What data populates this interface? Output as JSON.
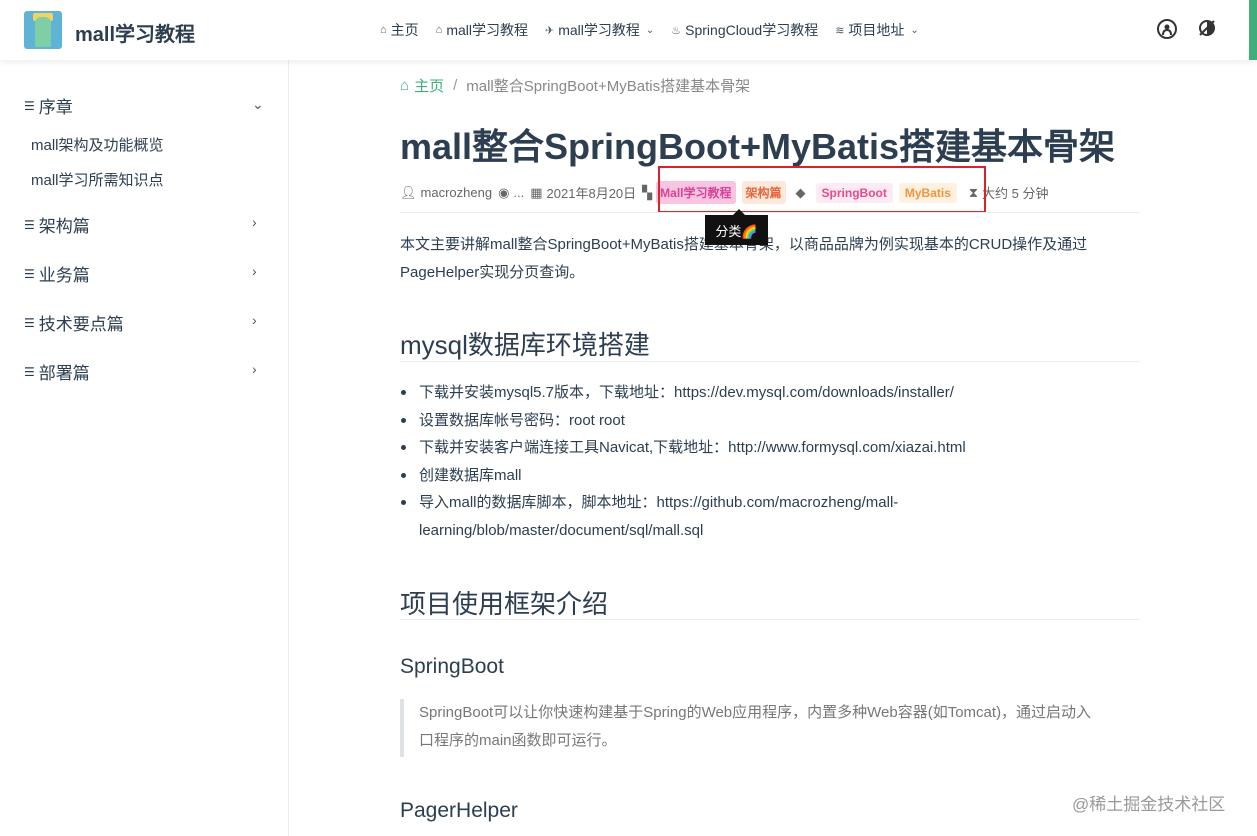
{
  "navbar": {
    "site_name": "mall学习教程",
    "links": [
      {
        "icon": "home-icon",
        "label": "主页"
      },
      {
        "icon": "home-icon",
        "label": "mall学习教程"
      },
      {
        "icon": "rocket-icon",
        "label": "mall学习教程"
      },
      {
        "icon": "fire-icon",
        "label": "SpringCloud学习教程"
      },
      {
        "icon": "layers-icon",
        "label": "项目地址"
      }
    ],
    "right_icons": [
      "github-icon",
      "theme-toggle-icon"
    ]
  },
  "sidebar": {
    "groups": [
      {
        "label": "序章",
        "expanded": true,
        "children": [
          "mall架构及功能概览",
          "mall学习所需知识点"
        ]
      },
      {
        "label": "架构篇",
        "expanded": false
      },
      {
        "label": "业务篇",
        "expanded": false
      },
      {
        "label": "技术要点篇",
        "expanded": false
      },
      {
        "label": "部署篇",
        "expanded": false
      }
    ]
  },
  "breadcrumb": {
    "home": "主页",
    "current": "mall整合SpringBoot+MyBatis搭建基本骨架"
  },
  "article": {
    "title": "mall整合SpringBoot+MyBatis搭建基本骨架",
    "meta": {
      "author": "macrozheng",
      "views": "...",
      "date": "2021年8月20日",
      "categories": [
        "Mall学习教程",
        "架构篇"
      ],
      "tags": [
        "SpringBoot",
        "MyBatis"
      ],
      "reading_time": "大约 5 分钟"
    },
    "tooltip": "分类🌈",
    "intro_line1": "本文主要讲解mall整合SpringBoot+MyBatis搭建基本骨架，以商品品牌为例实现基本的CRUD操作及通过",
    "intro_line2": "PageHelper实现分页查询。",
    "section1": {
      "heading": "mysql数据库环境搭建",
      "items": [
        "下载并安装mysql5.7版本，下载地址：https://dev.mysql.com/downloads/installer/",
        "设置数据库帐号密码：root root",
        "下载并安装客户端连接工具Navicat,下载地址：http://www.formysql.com/xiazai.html",
        "创建数据库mall",
        "导入mall的数据库脚本，脚本地址：https://github.com/macrozheng/mall-",
        "learning/blob/master/document/sql/mall.sql"
      ]
    },
    "section2": {
      "heading": "项目使用框架介绍",
      "sub1_heading": "SpringBoot",
      "sub1_quote_line1": "SpringBoot可以让你快速构建基于Spring的Web应用程序，内置多种Web容器(如Tomcat)，通过启动入",
      "sub1_quote_line2": "口程序的main函数即可运行。",
      "sub2_heading": "PagerHelper"
    }
  },
  "watermark": "@稀土掘金技术社区",
  "colors": {
    "accent": "#3eaf7c",
    "highlight_border": "#d9222a",
    "text": "#2c3e50"
  }
}
